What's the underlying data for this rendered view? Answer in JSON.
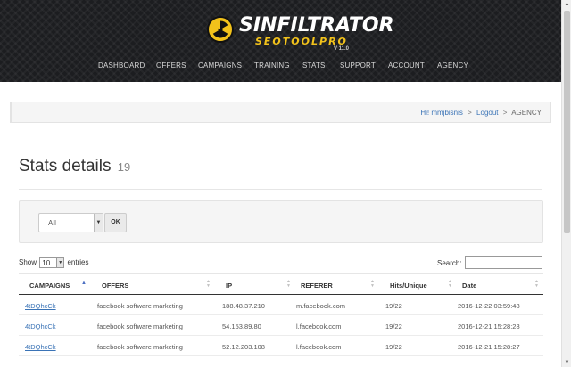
{
  "brand": {
    "name": "SINFILTRATOR",
    "tagline": "SEOTOOLPRO",
    "version": "V 11.0",
    "accent": "#f2c21b"
  },
  "nav": [
    "DASHBOARD",
    "OFFERS",
    "CAMPAIGNS",
    "TRAINING",
    "STATS",
    "SUPPORT",
    "ACCOUNT",
    "AGENCY"
  ],
  "breadcrumb": {
    "user": "Hi! mmjbisnis",
    "sep1": ">",
    "logout": "Logout",
    "sep2": ">",
    "current": "AGENCY"
  },
  "page": {
    "title": "Stats details",
    "count": "19"
  },
  "filter": {
    "selected": "All",
    "ok_label": "OK"
  },
  "table_controls": {
    "show_label": "Show",
    "page_length": "10",
    "entries_label": "entries",
    "search_label": "Search:"
  },
  "table": {
    "columns": [
      "CAMPAIGNS",
      "OFFERS",
      "IP",
      "REFERER",
      "Hits/Unique",
      "Date"
    ],
    "rows": [
      [
        "4tDQhcCk",
        "facebook software marketing",
        "188.48.37.210",
        "m.facebook.com",
        "19/22",
        "2016-12-22 03:59:48"
      ],
      [
        "4tDQhcCk",
        "facebook software marketing",
        "54.153.89.80",
        "l.facebook.com",
        "19/22",
        "2016-12-21 15:28:28"
      ],
      [
        "4tDQhcCk",
        "facebook software marketing",
        "52.12.203.108",
        "l.facebook.com",
        "19/22",
        "2016-12-21 15:28:27"
      ]
    ]
  },
  "icons": {
    "logo": "radiation-icon",
    "dropdown": "chevron-down-icon",
    "sort_asc": "sort-asc-icon",
    "sort_both": "sort-icon"
  },
  "colors": {
    "header_bg": "#1c1d20",
    "link": "#3a73b6",
    "sort_active": "#4b6fc2"
  }
}
